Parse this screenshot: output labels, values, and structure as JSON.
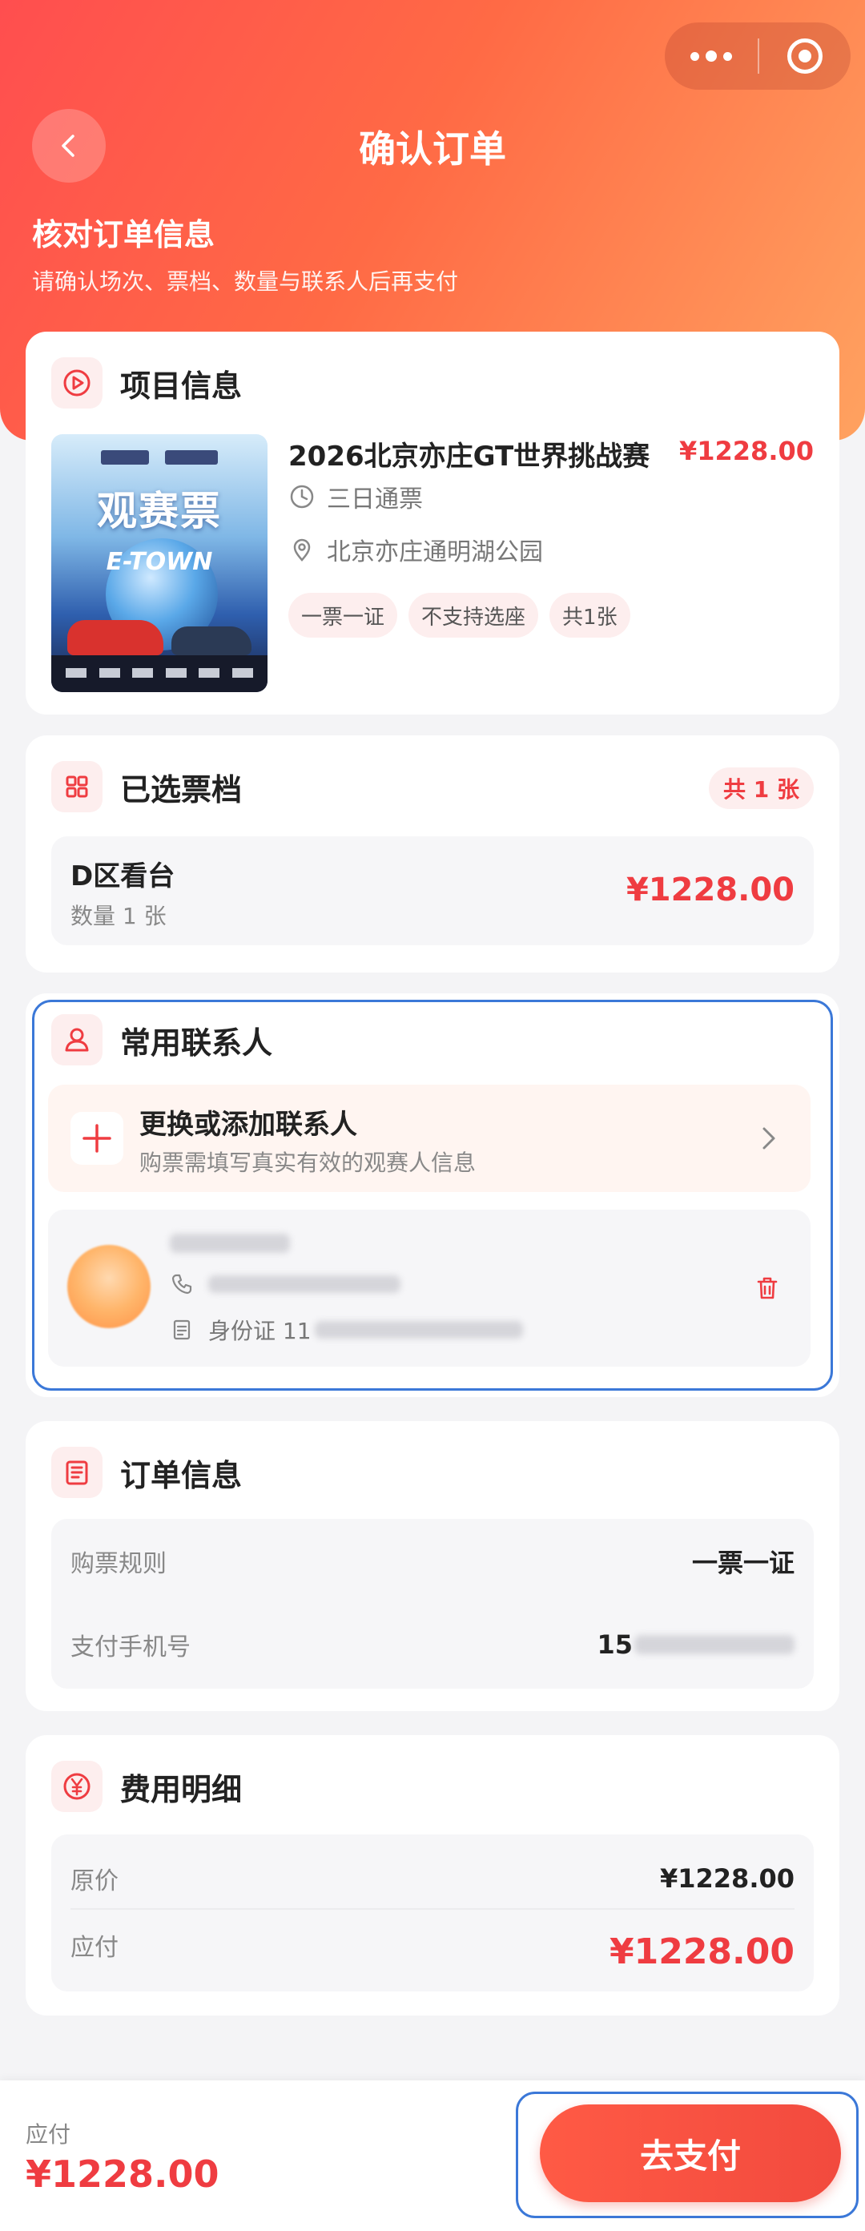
{
  "nav": {
    "title": "确认订单"
  },
  "hero": {
    "title": "核对订单信息",
    "subtitle": "请确认场次、票档、数量与联系人后再支付"
  },
  "project": {
    "section_title": "项目信息",
    "poster_text": "观赛票",
    "poster_subtext": "E-TOWN",
    "name": "2026北京亦庄GT世界挑战赛",
    "price": "¥1228.00",
    "ticket_type": "三日通票",
    "venue": "北京亦庄通明湖公园",
    "tags": [
      "一票一证",
      "不支持选座",
      "共1张"
    ]
  },
  "tier": {
    "section_title": "已选票档",
    "count_badge": "共 1 张",
    "name": "D区看台",
    "quantity": "数量 1 张",
    "price": "¥1228.00"
  },
  "contacts": {
    "section_title": "常用联系人",
    "add_title": "更换或添加联系人",
    "add_subtitle": "购票需填写真实有效的观赛人信息",
    "id_label": "身份证 11"
  },
  "order_info": {
    "section_title": "订单信息",
    "rule_label": "购票规则",
    "rule_value": "一票一证",
    "phone_label": "支付手机号",
    "phone_value": "15"
  },
  "fees": {
    "section_title": "费用明细",
    "original_label": "原价",
    "original_value": "¥1228.00",
    "payable_label": "应付",
    "payable_value": "¥1228.00"
  },
  "bottom": {
    "label": "应付",
    "amount": "¥1228.00",
    "pay_button": "去支付"
  },
  "colors": {
    "accent": "#ef3c41",
    "gradient_start": "#ff4e4f",
    "gradient_end": "#ffa260",
    "highlight_border": "#3b78d8"
  }
}
